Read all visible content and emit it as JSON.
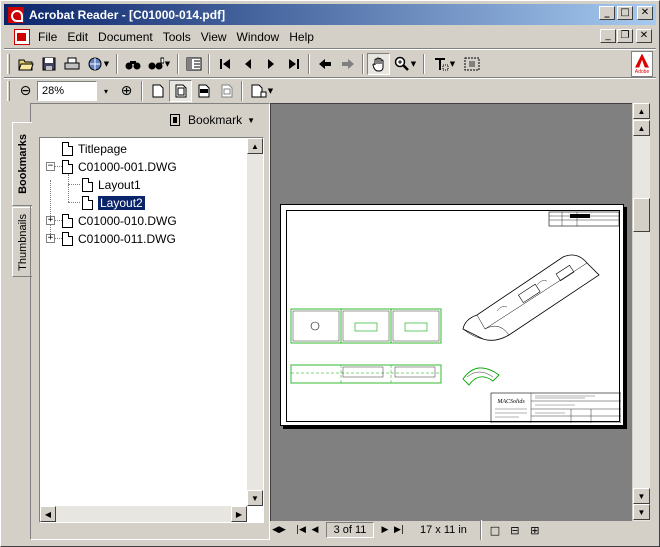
{
  "window": {
    "title": "Acrobat Reader - [C01000-014.pdf]"
  },
  "caption_buttons": {
    "minimize": "_",
    "maximize": "□",
    "close": "✕"
  },
  "mdi_buttons": {
    "minimize": "_",
    "restore": "❐",
    "close": "✕"
  },
  "menu": [
    "File",
    "Edit",
    "Document",
    "Tools",
    "View",
    "Window",
    "Help"
  ],
  "toolbar": {
    "zoom_value": "28%",
    "zoom_out": "⊖",
    "zoom_in": "⊕",
    "dropdown_arrow": "▾"
  },
  "adobe_logo_text": "Adobe",
  "side_tabs": {
    "bookmarks": "Bookmarks",
    "thumbnails": "Thumbnails"
  },
  "bookmark_panel": {
    "menu_label": "Bookmark"
  },
  "bookmarks": [
    {
      "label": "Titlepage",
      "level": 0,
      "expander": ""
    },
    {
      "label": "C01000-001.DWG",
      "level": 0,
      "expander": "−"
    },
    {
      "label": "Layout1",
      "level": 1,
      "expander": ""
    },
    {
      "label": "Layout2",
      "level": 1,
      "expander": "",
      "selected": true
    },
    {
      "label": "C01000-010.DWG",
      "level": 0,
      "expander": "+"
    },
    {
      "label": "C01000-011.DWG",
      "level": 0,
      "expander": "+"
    }
  ],
  "document": {
    "title_block_company": "MACSolids"
  },
  "statusbar": {
    "page_indicator": "3 of 11",
    "page_size": "17 x 11 in"
  }
}
